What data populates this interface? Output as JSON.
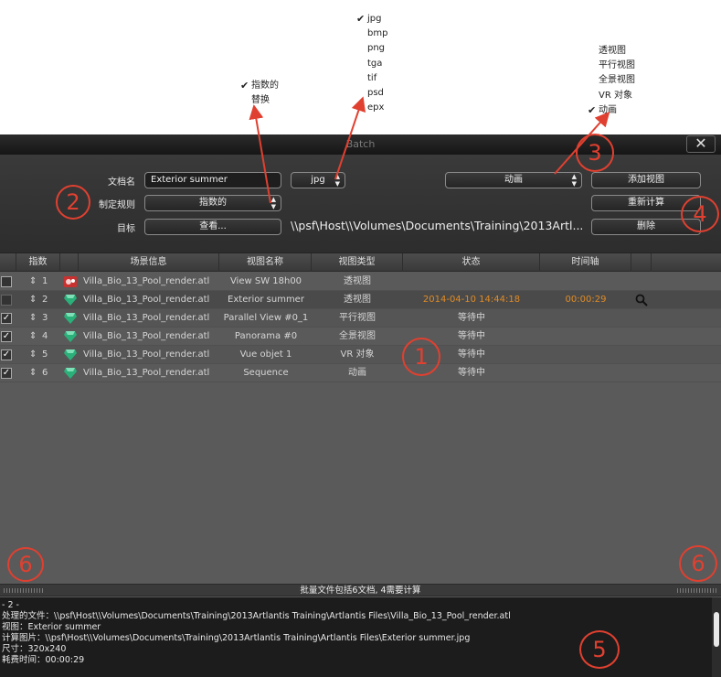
{
  "menus": {
    "rule_menu": {
      "items": [
        {
          "label": "指数的",
          "checked": true
        },
        {
          "label": "替换",
          "checked": false
        }
      ]
    },
    "format_menu": {
      "items": [
        {
          "label": "jpg",
          "checked": true
        },
        {
          "label": "bmp",
          "checked": false
        },
        {
          "label": "png",
          "checked": false
        },
        {
          "label": "tga",
          "checked": false
        },
        {
          "label": "tif",
          "checked": false
        },
        {
          "label": "psd",
          "checked": false
        },
        {
          "label": "epx",
          "checked": false
        }
      ]
    },
    "view_menu": {
      "items": [
        {
          "label": "透视图",
          "checked": false
        },
        {
          "label": "平行视图",
          "checked": false
        },
        {
          "label": "全景视图",
          "checked": false
        },
        {
          "label": "VR 对象",
          "checked": false
        },
        {
          "label": "动画",
          "checked": true
        }
      ]
    }
  },
  "window": {
    "title": "Batch",
    "close_label": "✕"
  },
  "controls": {
    "filename_label": "文档名",
    "filename_value": "Exterior summer",
    "format_value": "jpg",
    "rule_label": "制定规则",
    "rule_value": "指数的",
    "target_label": "目标",
    "browse_label": "查看...",
    "target_path": "\\\\psf\\Host\\\\Volumes\\Documents\\Training\\2013Artl...",
    "view_type_value": "动画",
    "add_view_label": "添加视图",
    "recompute_label": "重新计算",
    "delete_label": "删除"
  },
  "table": {
    "headers": {
      "index": "指数",
      "scene": "场景信息",
      "view_name": "视图名称",
      "view_type": "视图类型",
      "status": "状态",
      "time": "时间轴"
    },
    "rows": [
      {
        "checked": false,
        "index": "1",
        "scene": "Villa_Bio_13_Pool_render.atl",
        "view_name": "View SW 18h00",
        "view_type": "透视图",
        "status": "",
        "time": "",
        "icon": "render-icon"
      },
      {
        "checked": false,
        "index": "2",
        "scene": "Villa_Bio_13_Pool_render.atl",
        "view_name": "Exterior summer",
        "view_type": "透视图",
        "status": "2014-04-10 14:44:18",
        "time": "00:00:29",
        "icon": "gem-icon"
      },
      {
        "checked": true,
        "index": "3",
        "scene": "Villa_Bio_13_Pool_render.atl",
        "view_name": "Parallel View #0_1",
        "view_type": "平行视图",
        "status": "等待中",
        "time": "",
        "icon": "gem-icon"
      },
      {
        "checked": true,
        "index": "4",
        "scene": "Villa_Bio_13_Pool_render.atl",
        "view_name": "Panorama #0",
        "view_type": "全景视图",
        "status": "等待中",
        "time": "",
        "icon": "gem-icon"
      },
      {
        "checked": true,
        "index": "5",
        "scene": "Villa_Bio_13_Pool_render.atl",
        "view_name": "Vue objet 1",
        "view_type": "VR 对象",
        "status": "等待中",
        "time": "",
        "icon": "gem-icon"
      },
      {
        "checked": true,
        "index": "6",
        "scene": "Villa_Bio_13_Pool_render.atl",
        "view_name": "Sequence",
        "view_type": "动画",
        "status": "等待中",
        "time": "",
        "icon": "gem-icon"
      }
    ]
  },
  "summary": "批量文件包括6文档, 4需要计算",
  "log": [
    "- 2 -",
    "处理的文件：\\\\psf\\Host\\\\Volumes\\Documents\\Training\\2013Artlantis Training\\Artlantis Files\\Villa_Bio_13_Pool_render.atl",
    "视图：Exterior summer",
    "计算图片：\\\\psf\\Host\\\\Volumes\\Documents\\Training\\2013Artlantis Training\\Artlantis Files\\Exterior summer.jpg",
    "尺寸：320x240",
    "耗费时间：00:00:29"
  ],
  "annotations": [
    "1",
    "2",
    "3",
    "4",
    "5",
    "6",
    "6"
  ],
  "colors": {
    "annotation": "#e04030",
    "accent_time": "#e08b25"
  }
}
